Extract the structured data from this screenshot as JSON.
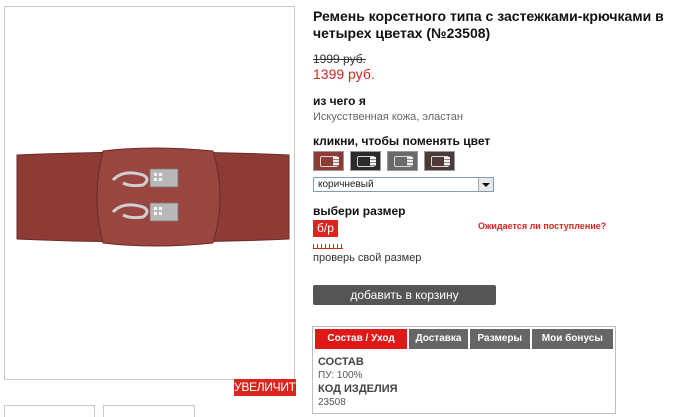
{
  "product": {
    "title": "Ремень корсетного типа с застежками-крючками в четырех цветах (№23508)",
    "old_price": "1999 руб.",
    "new_price": "1399 руб."
  },
  "gallery": {
    "zoom_label": "УВЕЛИЧИТЬ"
  },
  "material": {
    "label": "из чего я",
    "value": "Искусственная кожа, эластан"
  },
  "color": {
    "label": "кликни, чтобы поменять цвет",
    "swatches": [
      {
        "name": "swatch-brown",
        "color": "#8e3b35"
      },
      {
        "name": "swatch-black",
        "color": "#2b2b2b"
      },
      {
        "name": "swatch-grey",
        "color": "#6a6a6a"
      },
      {
        "name": "swatch-dark-brown",
        "color": "#4d3a38"
      }
    ],
    "selected": "коричневый"
  },
  "size": {
    "label": "выбери размер",
    "option": "б/р",
    "expected_link": "Ожидается ли поступление?",
    "check_size": "проверь свой размер"
  },
  "cart": {
    "button_label": "добавить в корзину"
  },
  "info_tabs": {
    "tabs": [
      "Состав / Уход",
      "Доставка",
      "Размеры",
      "Мои бонусы"
    ],
    "active_index": 0,
    "composition_heading": "СОСТАВ",
    "composition_value": "ПУ: 100%",
    "code_heading": "КОД ИЗДЕЛИЯ",
    "code_value": "23508"
  },
  "colors": {
    "accent": "#d8261f",
    "belt": "#8e3b35",
    "button": "#555555"
  }
}
